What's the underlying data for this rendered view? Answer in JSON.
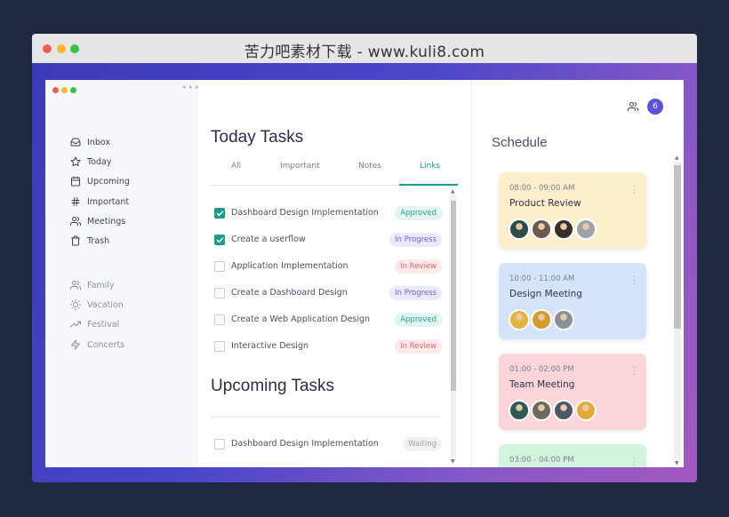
{
  "outer": {
    "title": "苦力吧素材下载 - www.kuli8.com"
  },
  "sidebar": {
    "main_items": [
      {
        "label": "Inbox",
        "icon": "inbox-icon"
      },
      {
        "label": "Today",
        "icon": "star-icon"
      },
      {
        "label": "Upcoming",
        "icon": "calendar-icon"
      },
      {
        "label": "Important",
        "icon": "hash-icon"
      },
      {
        "label": "Meetings",
        "icon": "users-icon"
      },
      {
        "label": "Trash",
        "icon": "trash-icon"
      }
    ],
    "tag_items": [
      {
        "label": "Family",
        "icon": "users-icon"
      },
      {
        "label": "Vacation",
        "icon": "sun-icon"
      },
      {
        "label": "Festival",
        "icon": "trending-up-icon"
      },
      {
        "label": "Concerts",
        "icon": "zap-icon"
      }
    ]
  },
  "tasks": {
    "today_title": "Today Tasks",
    "tabs": [
      {
        "label": "All",
        "active": false
      },
      {
        "label": "Important",
        "active": false
      },
      {
        "label": "Notes",
        "active": false
      },
      {
        "label": "Links",
        "active": true
      }
    ],
    "today": [
      {
        "name": "Dashboard Design Implementation",
        "checked": true,
        "status": "Approved",
        "status_type": "approved"
      },
      {
        "name": "Create a userflow",
        "checked": true,
        "status": "In Progress",
        "status_type": "progress"
      },
      {
        "name": "Application Implementation",
        "checked": false,
        "status": "In Review",
        "status_type": "review"
      },
      {
        "name": "Create a Dashboard Design",
        "checked": false,
        "status": "In Progress",
        "status_type": "progress"
      },
      {
        "name": "Create a Web Application Design",
        "checked": false,
        "status": "Approved",
        "status_type": "approved"
      },
      {
        "name": "Interactive Design",
        "checked": false,
        "status": "In Review",
        "status_type": "review"
      }
    ],
    "upcoming_title": "Upcoming Tasks",
    "upcoming": [
      {
        "name": "Dashboard Design Implementation",
        "checked": false,
        "status": "Waiting",
        "status_type": "waiting"
      }
    ]
  },
  "schedule": {
    "title": "Schedule",
    "notification_count": "6",
    "events": [
      {
        "time": "08:00 - 09:00 AM",
        "title": "Product Review",
        "color": "#fdefcc",
        "avatar_colors": [
          "#2b4d46",
          "#6d5a4e",
          "#3a2e2a",
          "#9fa2a8"
        ]
      },
      {
        "time": "10:00 - 11:00 AM",
        "title": "Design Meeting",
        "color": "#d6e4fb",
        "avatar_colors": [
          "#e4b23d",
          "#d49a2e",
          "#8c8f97"
        ]
      },
      {
        "time": "01:00 - 02:00 PM",
        "title": "Team Meeting",
        "color": "#fbd5d9",
        "avatar_colors": [
          "#2f5a52",
          "#6e6a5f",
          "#4d5968",
          "#e3aa3a"
        ]
      },
      {
        "time": "03:00 - 04:00 PM",
        "title": "",
        "color": "#d3f4dd",
        "avatar_colors": []
      }
    ]
  }
}
